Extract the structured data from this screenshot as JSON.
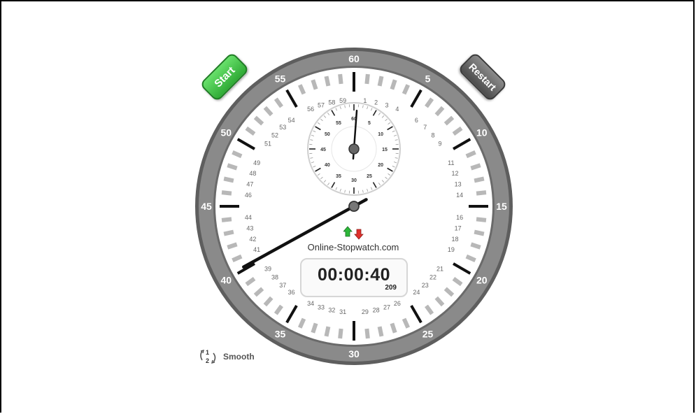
{
  "buttons": {
    "start": "Start",
    "restart": "Restart"
  },
  "display": {
    "time": "00:00:40",
    "milliseconds": "209",
    "brand": "Online-Stopwatch.com"
  },
  "mode": {
    "label": "Smooth",
    "icon": "cycle-12-icon"
  },
  "dial": {
    "major_labels": [
      "60",
      "5",
      "10",
      "15",
      "20",
      "25",
      "30",
      "35",
      "40",
      "45",
      "50",
      "55"
    ],
    "minor_labels": [
      "1",
      "2",
      "3",
      "4",
      "6",
      "7",
      "8",
      "9",
      "11",
      "12",
      "13",
      "14",
      "16",
      "17",
      "18",
      "19",
      "21",
      "22",
      "23",
      "24",
      "26",
      "27",
      "28",
      "29",
      "31",
      "32",
      "33",
      "34",
      "36",
      "37",
      "38",
      "39",
      "41",
      "42",
      "43",
      "44",
      "46",
      "47",
      "48",
      "49",
      "51",
      "52",
      "53",
      "54",
      "56",
      "57",
      "58",
      "59"
    ],
    "sub_labels": [
      "60",
      "5",
      "10",
      "15",
      "20",
      "25",
      "30",
      "35",
      "40",
      "45",
      "50",
      "55"
    ],
    "seconds_value": 40.2,
    "minutes_value": 0.7
  },
  "colors": {
    "start": "#3cc13f",
    "restart": "#5a5a5a",
    "bezel": "#7a7a7a",
    "up_arrow": "#2db83a",
    "down_arrow": "#e0302b"
  }
}
